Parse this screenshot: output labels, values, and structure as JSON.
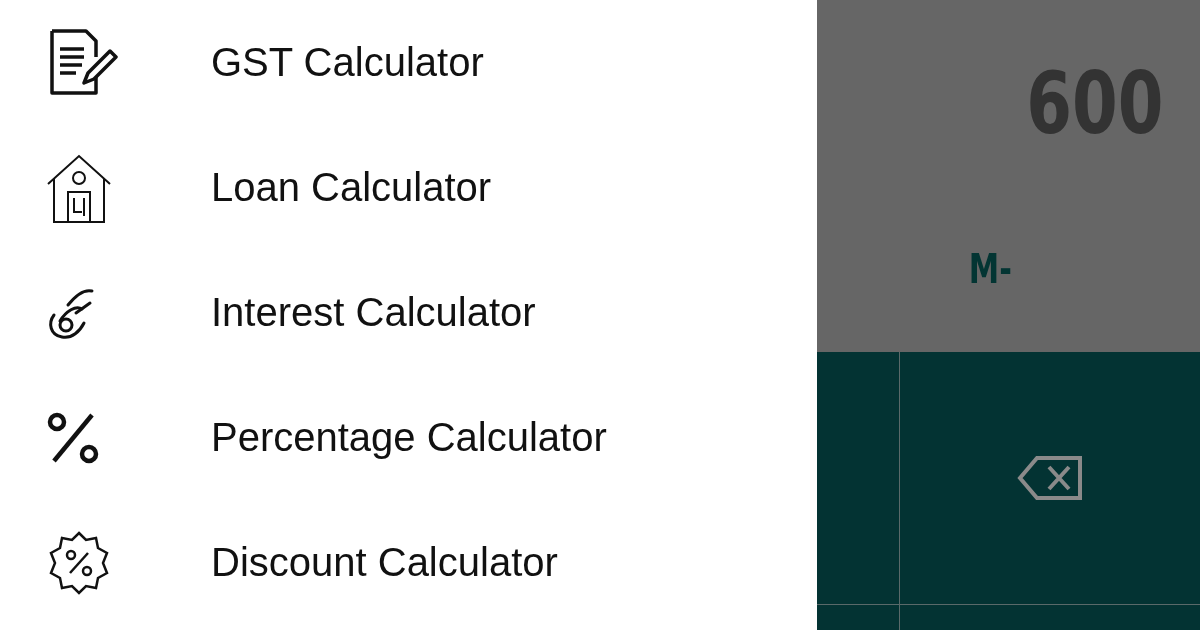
{
  "drawer": {
    "items": [
      {
        "kind": "document",
        "label": "GST Calculator"
      },
      {
        "kind": "house",
        "label": "Loan Calculator"
      },
      {
        "kind": "hand",
        "label": "Interest Calculator"
      },
      {
        "kind": "percent",
        "label": "Percentage Calculator"
      },
      {
        "kind": "badge",
        "label": "Discount Calculator"
      }
    ]
  },
  "calculator": {
    "display": "600",
    "memory_key": "M-"
  }
}
